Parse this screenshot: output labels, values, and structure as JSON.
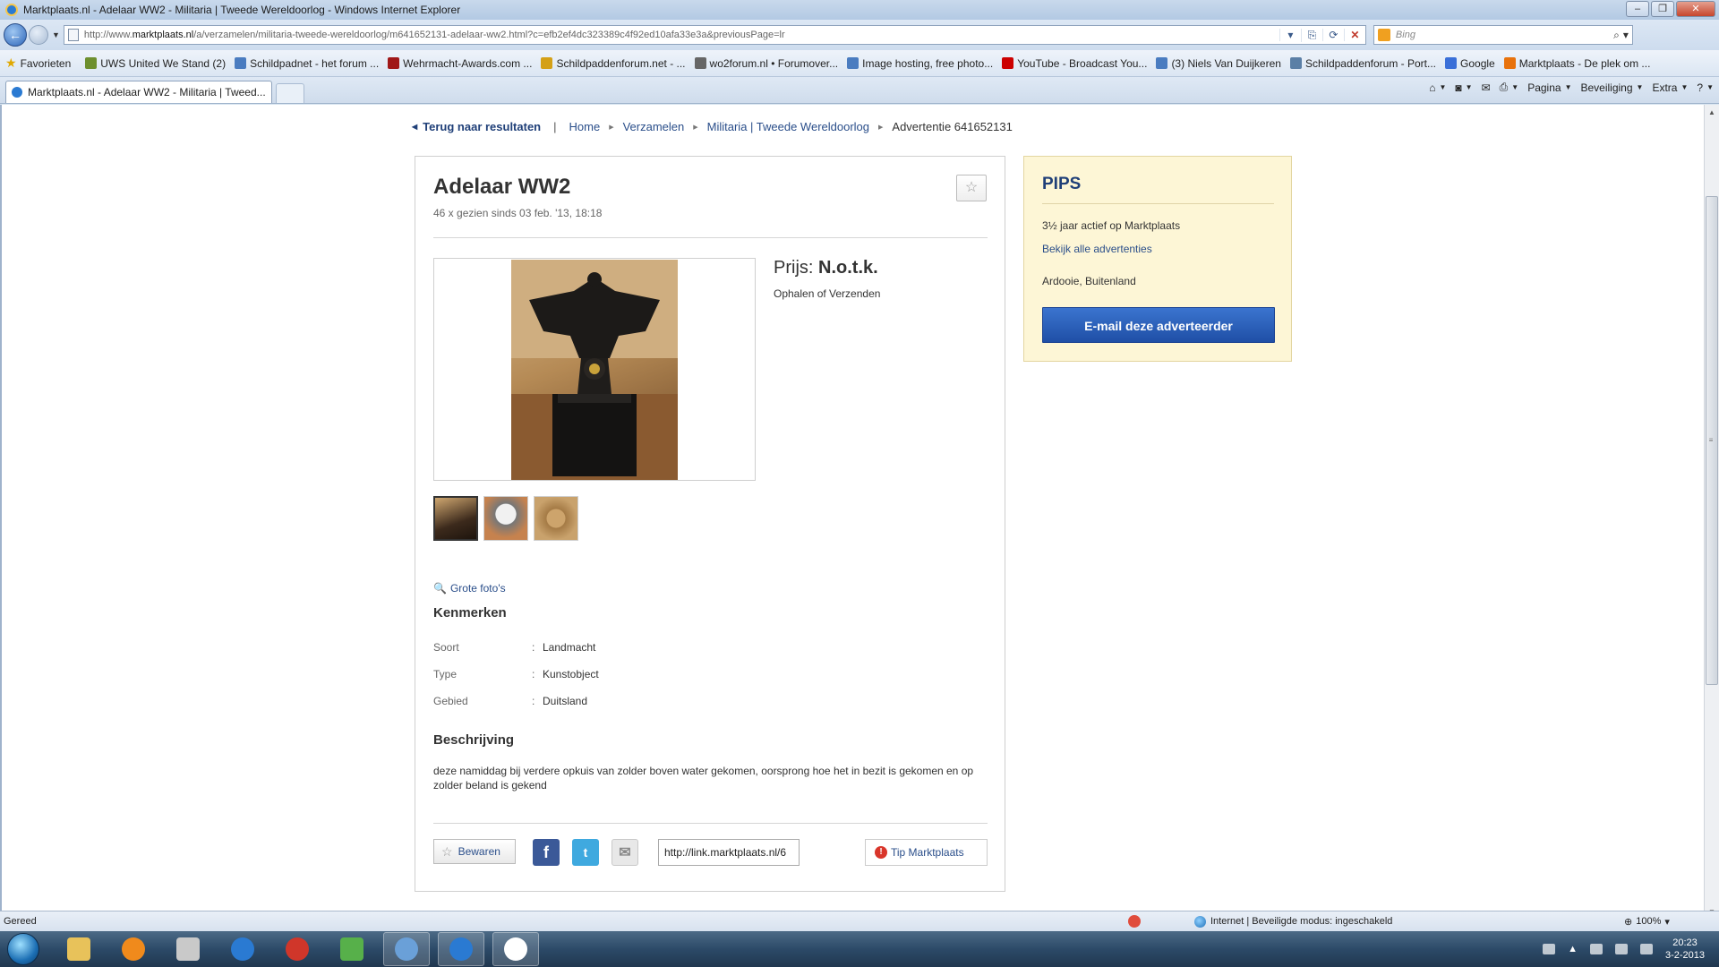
{
  "window": {
    "title": "Marktplaats.nl - Adelaar WW2 - Militaria | Tweede Wereldoorlog - Windows Internet Explorer"
  },
  "address": {
    "url_prefix": "http://www.",
    "url_domain": "marktplaats.nl",
    "url_rest": "/a/verzamelen/militaria-tweede-wereldoorlog/m641652131-adelaar-ww2.html?c=efb2ef4dc323389c4f92ed10afa33e3a&previousPage=lr",
    "search_placeholder": "Bing"
  },
  "favorites": {
    "label": "Favorieten",
    "items": [
      {
        "label": "UWS United We Stand (2)",
        "color": "#6d8f2e"
      },
      {
        "label": "Schildpadnet - het forum ...",
        "color": "#4a7cc0"
      },
      {
        "label": "Wehrmacht-Awards.com ...",
        "color": "#a01818"
      },
      {
        "label": "Schildpaddenforum.net - ...",
        "color": "#d4a017"
      },
      {
        "label": "wo2forum.nl • Forumover...",
        "color": "#666666"
      },
      {
        "label": "Image hosting, free photo...",
        "color": "#4a7cc0"
      },
      {
        "label": "YouTube - Broadcast You...",
        "color": "#cc0000"
      },
      {
        "label": "(3) Niels Van Duijkeren",
        "color": "#4a7cc0"
      },
      {
        "label": "Schildpaddenforum - Port...",
        "color": "#5b7fa6"
      },
      {
        "label": "Google",
        "color": "#3a6fd8"
      },
      {
        "label": "Marktplaats - De plek om ...",
        "color": "#e8720c"
      }
    ]
  },
  "tabs": [
    {
      "label": "Marktplaats.nl - Adelaar WW2 - Militaria | Tweed..."
    }
  ],
  "commandbar": {
    "page": "Pagina",
    "safety": "Beveiliging",
    "extra": "Extra"
  },
  "breadcrumb": {
    "back": "Terug naar resultaten",
    "items": [
      "Home",
      "Verzamelen",
      "Militaria | Tweede Wereldoorlog"
    ],
    "current": "Advertentie 641652131"
  },
  "ad": {
    "title": "Adelaar WW2",
    "views": "46 x gezien sinds 03 feb. '13, 18:18",
    "price_label": "Prijs:",
    "price_value": "N.o.t.k.",
    "delivery": "Ophalen of Verzenden",
    "big_photos": "Grote foto's",
    "features_heading": "Kenmerken",
    "features": [
      {
        "key": "Soort",
        "value": "Landmacht"
      },
      {
        "key": "Type",
        "value": "Kunstobject"
      },
      {
        "key": "Gebied",
        "value": "Duitsland"
      }
    ],
    "description_heading": "Beschrijving",
    "description": "deze namiddag bij verdere opkuis van zolder boven water gekomen, oorsprong hoe het in bezit is gekomen en op zolder beland is gekend",
    "save_label": "Bewaren",
    "share_link": "http://link.marktplaats.nl/6",
    "tip_label": "Tip Marktplaats"
  },
  "seller": {
    "name": "PIPS",
    "active": "3½ jaar actief op Marktplaats",
    "all_ads": "Bekijk alle advertenties",
    "location": "Ardooie, Buitenland",
    "email_button": "E-mail deze adverteerder"
  },
  "status": {
    "left": "Gereed",
    "zone": "Internet | Beveiligde modus: ingeschakeld",
    "zoom": "100%"
  },
  "taskbar": {
    "time": "20:23",
    "date": "3-2-2013"
  }
}
